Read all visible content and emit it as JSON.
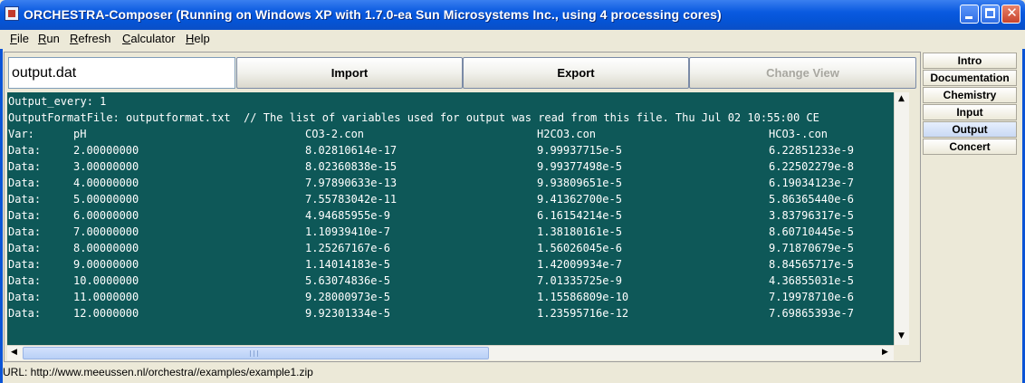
{
  "window": {
    "title": "ORCHESTRA-Composer (Running on Windows XP with 1.7.0-ea  Sun Microsystems Inc., using 4 processing cores)"
  },
  "menu": [
    {
      "label": "File",
      "mnemonic": "F",
      "rest": "ile"
    },
    {
      "label": "Run",
      "mnemonic": "R",
      "rest": "un"
    },
    {
      "label": "Refresh",
      "mnemonic": "R",
      "rest": "efresh"
    },
    {
      "label": "Calculator",
      "mnemonic": "C",
      "rest": "alculator"
    },
    {
      "label": "Help",
      "mnemonic": "H",
      "rest": "elp"
    }
  ],
  "toolbar": {
    "file_field_value": "output.dat",
    "import_label": "Import",
    "export_label": "Export",
    "change_view_label": "Change View",
    "change_view_enabled": false
  },
  "output": {
    "line1": "Output_every: 1",
    "line2": "OutputFormatFile: outputformat.txt  // The list of variables used for output was read from this file. Thu Jul 02 10:55:00 CE",
    "header": [
      "Var:",
      "pH",
      "CO3-2.con",
      "H2CO3.con",
      "HCO3-.con"
    ],
    "rows": [
      [
        "Data:",
        "2.00000000",
        "8.02810614e-17",
        "9.99937715e-5",
        "6.22851233e-9"
      ],
      [
        "Data:",
        "3.00000000",
        "8.02360838e-15",
        "9.99377498e-5",
        "6.22502279e-8"
      ],
      [
        "Data:",
        "4.00000000",
        "7.97890633e-13",
        "9.93809651e-5",
        "6.19034123e-7"
      ],
      [
        "Data:",
        "5.00000000",
        "7.55783042e-11",
        "9.41362700e-5",
        "5.86365440e-6"
      ],
      [
        "Data:",
        "6.00000000",
        "4.94685955e-9",
        "6.16154214e-5",
        "3.83796317e-5"
      ],
      [
        "Data:",
        "7.00000000",
        "1.10939410e-7",
        "1.38180161e-5",
        "8.60710445e-5"
      ],
      [
        "Data:",
        "8.00000000",
        "1.25267167e-6",
        "1.56026045e-6",
        "9.71870679e-5"
      ],
      [
        "Data:",
        "9.00000000",
        "1.14014183e-5",
        "1.42009934e-7",
        "8.84565717e-5"
      ],
      [
        "Data:",
        "10.0000000",
        "5.63074836e-5",
        "7.01335725e-9",
        "4.36855031e-5"
      ],
      [
        "Data:",
        "11.0000000",
        "9.28000973e-5",
        "1.15586809e-10",
        "7.19978710e-6"
      ],
      [
        "Data:",
        "12.0000000",
        "9.92301334e-5",
        "1.23595716e-12",
        "7.69865393e-7"
      ]
    ]
  },
  "tabs": [
    {
      "label": "Intro",
      "active": false
    },
    {
      "label": "Documentation",
      "active": false
    },
    {
      "label": "Chemistry",
      "active": false
    },
    {
      "label": "Input",
      "active": false
    },
    {
      "label": "Output",
      "active": true
    },
    {
      "label": "Concert",
      "active": false
    }
  ],
  "status": {
    "url_text": "URL: http://www.meeussen.nl/orchestra//examples/example1.zip"
  },
  "icons": {
    "app": "orchestra-app-icon",
    "minimize": "minimize-icon",
    "maximize": "maximize-icon",
    "close": "close-icon"
  },
  "colors": {
    "title_bar": "#0a5ae0",
    "output_background": "#0e5858",
    "output_text": "#ffffff",
    "active_tab": "#c9d9f4"
  }
}
